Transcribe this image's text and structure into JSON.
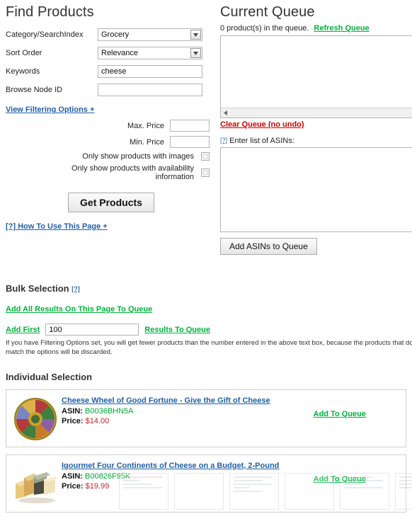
{
  "find_products": {
    "title": "Find Products",
    "fields": [
      {
        "label": "Category/SearchIndex",
        "type": "select",
        "value": "Grocery"
      },
      {
        "label": "Sort Order",
        "type": "select",
        "value": "Relevance"
      },
      {
        "label": "Keywords",
        "type": "text",
        "value": "cheese",
        "placeholder": ""
      },
      {
        "label": "Browse Node ID",
        "type": "text",
        "value": "",
        "placeholder": ""
      }
    ],
    "view_filtering_link": "View Filtering Options +",
    "max_price_label": "Max. Price",
    "max_price_value": "",
    "min_price_label": "Min. Price",
    "min_price_value": "",
    "checkbox_images_label": "Only show products with images",
    "checkbox_images_checked": false,
    "checkbox_availability_label": "Only show products with availability information",
    "checkbox_availability_checked": false,
    "get_products_button": "Get Products",
    "how_to_use_link": "[?] How To Use This Page +"
  },
  "current_queue": {
    "title": "Current Queue",
    "status_count": "0 product(s) in the queue.",
    "refresh_link": "Refresh Queue",
    "queue_contents": "",
    "clear_link": "Clear Queue (no undo)",
    "asin_help_mark": "[?]",
    "asin_label": "Enter list of ASINs:",
    "asin_value": "",
    "add_asins_button": "Add ASINs to Queue"
  },
  "bulk_selection": {
    "title": "Bulk Selection",
    "help_mark": "[?]",
    "add_all_link": "Add All Results On This Page To Queue",
    "add_first_label": "Add First",
    "add_first_value": "100",
    "results_to_queue_link": "Results To Queue",
    "note": "If you have Filtering Options set, you will get fewer products than the number entered in the above text box, because the products that do not match the options will be discarded."
  },
  "individual_selection": {
    "title": "Individual Selection",
    "asin_key": "ASIN:",
    "price_key": "Price:",
    "add_to_queue_label": "Add To Queue",
    "products": [
      {
        "title": "Cheese Wheel of Good Fortune - Give the Gift of Cheese",
        "asin": "B0036BHN5A",
        "price": "$14.00",
        "thumb": "cheese-wheel-image"
      },
      {
        "title": "Igourmet Four Continents of Cheese on a Budget, 2-Pound",
        "asin": "B00826F95K",
        "price": "$19.99",
        "thumb": "cheese-assortment-image"
      }
    ]
  },
  "colors": {
    "link_green": "#00b33c",
    "link_blue": "#1f5fa9",
    "link_red": "#cc0000",
    "asin_green": "#00a838",
    "price_red": "#cc2222"
  }
}
